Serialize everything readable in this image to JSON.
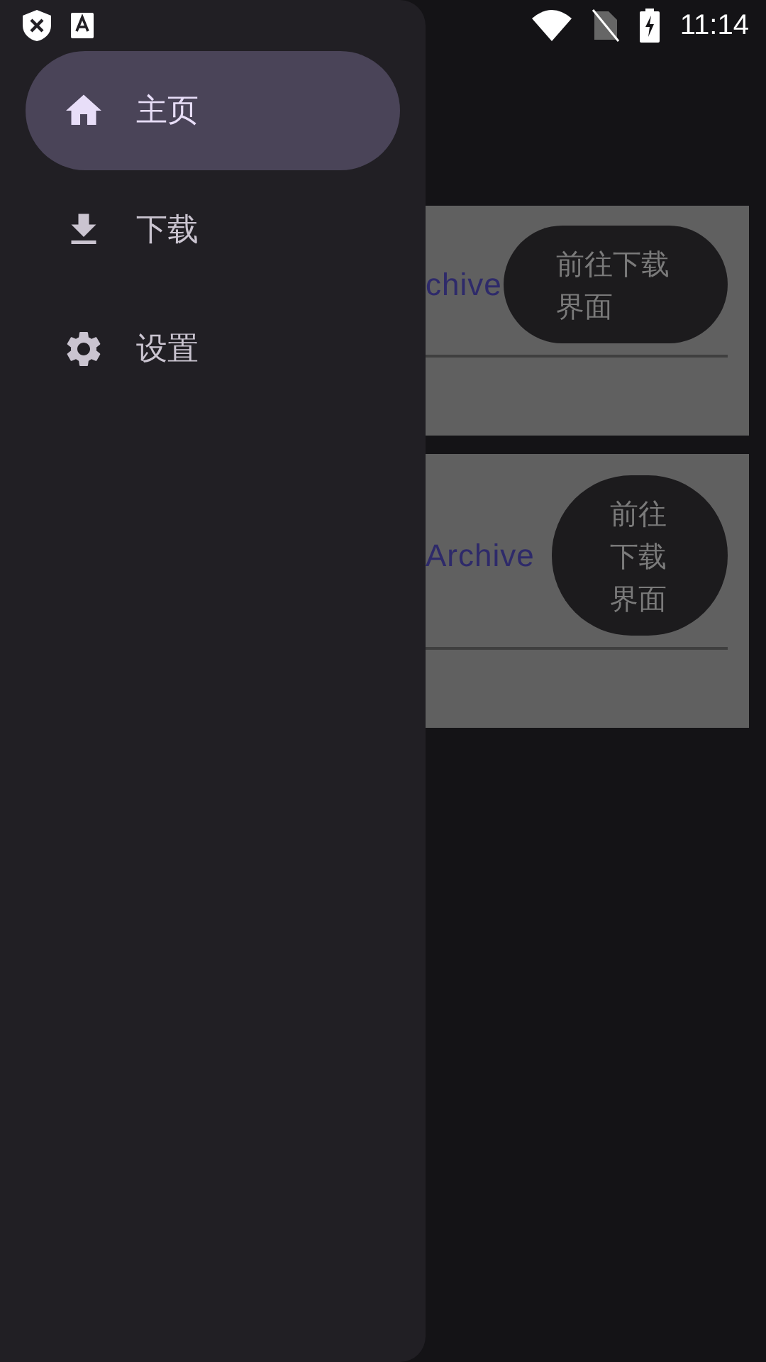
{
  "status_bar": {
    "time": "11:14"
  },
  "drawer": {
    "items": [
      {
        "label": "主页",
        "kind": "home",
        "selected": true
      },
      {
        "label": "下载",
        "kind": "download",
        "selected": false
      },
      {
        "label": "设置",
        "kind": "settings",
        "selected": false
      }
    ]
  },
  "cards": [
    {
      "title": "chive",
      "button": "前往下载界面",
      "kind": "wide"
    },
    {
      "title": "Archive",
      "button": "前往下载界面",
      "kind": "round"
    }
  ]
}
